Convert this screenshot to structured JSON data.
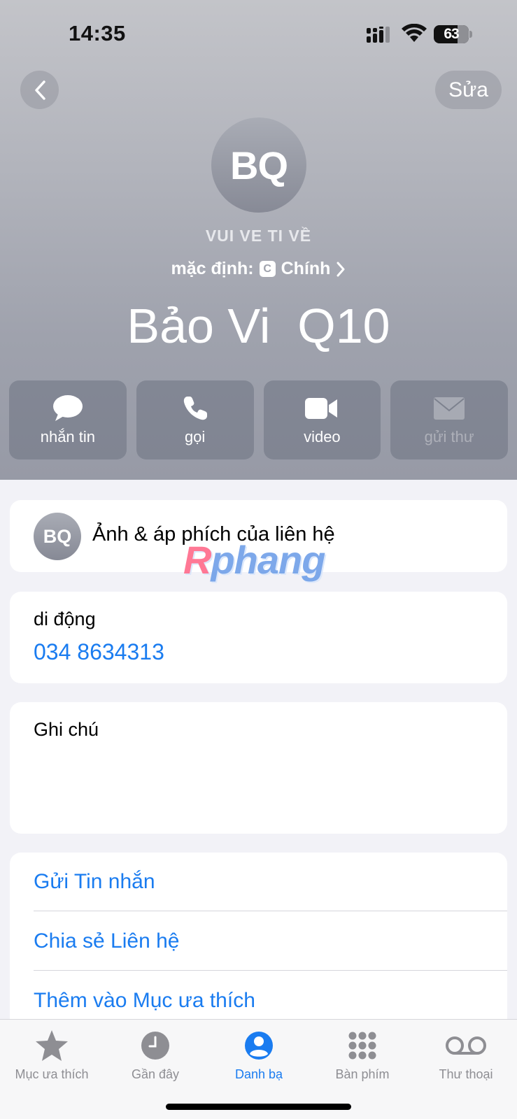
{
  "status_bar": {
    "time": "14:35",
    "battery": "63"
  },
  "nav": {
    "edit_label": "Sửa"
  },
  "contact": {
    "initials": "BQ",
    "company": "VUI VE TI VỀ",
    "default_prefix": "mặc định:",
    "sim_badge": "C",
    "default_line": "Chính",
    "name": "Bảo Vi  Q10"
  },
  "actions": [
    {
      "label": "nhắn tin",
      "icon": "message-bubble-icon"
    },
    {
      "label": "gọi",
      "icon": "phone-icon"
    },
    {
      "label": "video",
      "icon": "video-camera-icon"
    },
    {
      "label": "gửi thư",
      "icon": "mail-icon",
      "disabled": true
    }
  ],
  "poster": {
    "initials": "BQ",
    "label": "Ảnh & áp phích của liên hệ"
  },
  "watermark": {
    "prefix": "R",
    "text": "phang"
  },
  "phone": {
    "label": "di động",
    "number": "034 8634313"
  },
  "notes": {
    "label": "Ghi chú"
  },
  "links": [
    "Gửi Tin nhắn",
    "Chia sẻ Liên hệ",
    "Thêm vào Mục ưa thích"
  ],
  "tabs": [
    {
      "label": "Mục ưa thích",
      "icon": "star-icon"
    },
    {
      "label": "Gần đây",
      "icon": "clock-icon"
    },
    {
      "label": "Danh bạ",
      "icon": "person-circle-icon",
      "active": true
    },
    {
      "label": "Bàn phím",
      "icon": "keypad-icon"
    },
    {
      "label": "Thư thoại",
      "icon": "voicemail-icon"
    }
  ],
  "colors": {
    "accent": "#1a7cf0",
    "header": "#a9acb5"
  }
}
